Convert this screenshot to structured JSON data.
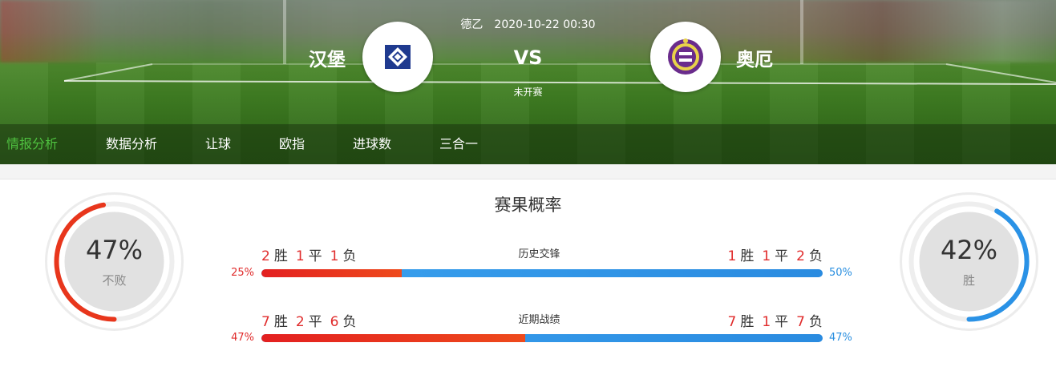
{
  "match": {
    "league": "德乙",
    "datetime": "2020-10-22 00:30",
    "vs": "VS",
    "status": "未开赛",
    "home": {
      "name": "汉堡",
      "logo_icon": "hamburg-diamond-crest-icon"
    },
    "away": {
      "name": "奥厄",
      "logo_icon": "aue-crest-icon"
    }
  },
  "tabs": [
    {
      "label": "情报分析",
      "active": true
    },
    {
      "label": "数据分析",
      "active": false
    },
    {
      "label": "让球",
      "active": false
    },
    {
      "label": "欧指",
      "active": false
    },
    {
      "label": "进球数",
      "active": false
    },
    {
      "label": "三合一",
      "active": false
    }
  ],
  "probability": {
    "title": "赛果概率",
    "home_gauge": {
      "value": "47%",
      "label": "不败",
      "fraction": 0.47,
      "color": "#e8361c"
    },
    "away_gauge": {
      "value": "42%",
      "label": "胜",
      "fraction": 0.42,
      "color": "#2a92e6"
    }
  },
  "rows": [
    {
      "title": "历史交锋",
      "home": {
        "w": "2",
        "d": "1",
        "l": "1"
      },
      "away": {
        "w": "1",
        "d": "1",
        "l": "2"
      },
      "home_pct": "25%",
      "away_pct": "50%",
      "home_share": 0.25
    },
    {
      "title": "近期战绩",
      "home": {
        "w": "7",
        "d": "2",
        "l": "6"
      },
      "away": {
        "w": "7",
        "d": "1",
        "l": "7"
      },
      "home_pct": "47%",
      "away_pct": "47%",
      "home_share": 0.47
    }
  ],
  "words": {
    "win": "胜",
    "draw": "平",
    "loss": "负"
  },
  "colors": {
    "home": "#e02b2b",
    "away": "#2a8fe0",
    "active_tab": "#4fc240"
  }
}
